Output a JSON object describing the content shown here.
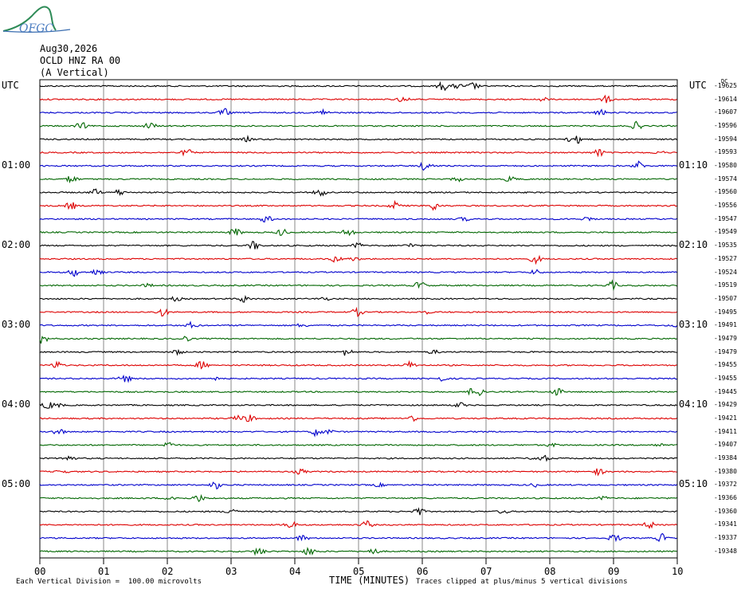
{
  "header": {
    "logo_text": "OFGC",
    "date": "Aug30,2026",
    "station": "OCLD HNZ RA 00",
    "component": "(A Vertical)"
  },
  "utc_left": "UTC",
  "utc_right": "UTC",
  "dc_label": "DC",
  "chart_data": {
    "type": "line",
    "description_axes": "helicorder",
    "xlabel": "TIME (MINUTES)",
    "x_ticks": [
      "00",
      "01",
      "02",
      "03",
      "04",
      "05",
      "06",
      "07",
      "08",
      "09",
      "10"
    ],
    "xlim": [
      0,
      10
    ],
    "left_hour_labels": [
      {
        "row": 6,
        "label": "01:00"
      },
      {
        "row": 12,
        "label": "02:00"
      },
      {
        "row": 18,
        "label": "03:00"
      },
      {
        "row": 24,
        "label": "04:00"
      },
      {
        "row": 30,
        "label": "05:00"
      }
    ],
    "right_hour_labels": [
      {
        "row": 6,
        "label": "01:10"
      },
      {
        "row": 12,
        "label": "02:10"
      },
      {
        "row": 18,
        "label": "03:10"
      },
      {
        "row": 24,
        "label": "04:10"
      },
      {
        "row": 30,
        "label": "05:10"
      }
    ],
    "trace_colors": [
      "#000000",
      "#dd0000",
      "#0000cc",
      "#006600"
    ],
    "dc_offsets": [
      -19625,
      -19614,
      -19607,
      -19596,
      -19594,
      -19593,
      -19580,
      -19574,
      -19560,
      -19556,
      -19547,
      -19549,
      -19535,
      -19527,
      -19524,
      -19519,
      -19507,
      -19495,
      -19491,
      -19479,
      -19479,
      -19455,
      -19455,
      -19445,
      -19429,
      -19421,
      -19411,
      -19407,
      -19384,
      -19380,
      -19372,
      -19366,
      -19360,
      -19341,
      -19337,
      -19348
    ],
    "scale_note": "Each Vertical Division =  100.00 microvolts",
    "clip_note": "Traces clipped at plus/minus 5 vertical divisions"
  }
}
